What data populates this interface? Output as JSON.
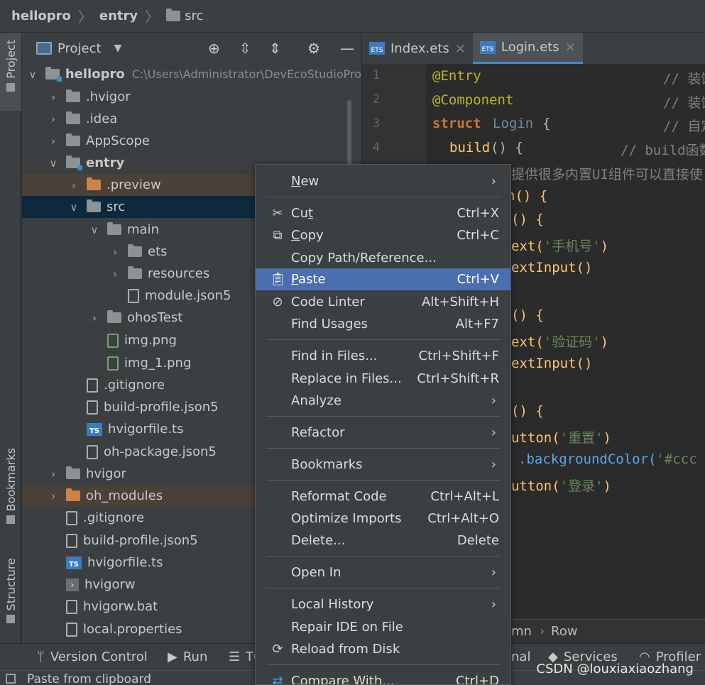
{
  "breadcrumb": {
    "project": "hellopro",
    "module": "entry",
    "folder": "src"
  },
  "left_strip": {
    "project": "Project",
    "bookmarks": "Bookmarks",
    "structure": "Structure"
  },
  "project_panel": {
    "title": "Project",
    "tree": [
      {
        "label": "hellopro",
        "path": "C:\\Users\\Administrator\\DevEcoStudioPro"
      },
      {
        "label": ".hvigor"
      },
      {
        "label": ".idea"
      },
      {
        "label": "AppScope"
      },
      {
        "label": "entry"
      },
      {
        "label": ".preview"
      },
      {
        "label": "src"
      },
      {
        "label": "main"
      },
      {
        "label": "ets"
      },
      {
        "label": "resources"
      },
      {
        "label": "module.json5"
      },
      {
        "label": "ohosTest"
      },
      {
        "label": "img.png"
      },
      {
        "label": "img_1.png"
      },
      {
        "label": ".gitignore"
      },
      {
        "label": "build-profile.json5"
      },
      {
        "label": "hvigorfile.ts"
      },
      {
        "label": "oh-package.json5"
      },
      {
        "label": "hvigor"
      },
      {
        "label": "oh_modules"
      },
      {
        "label": ".gitignore"
      },
      {
        "label": "build-profile.json5"
      },
      {
        "label": "hvigorfile.ts"
      },
      {
        "label": "hvigorw"
      },
      {
        "label": "hvigorw.bat"
      },
      {
        "label": "local.properties"
      }
    ]
  },
  "editor": {
    "tabs": [
      {
        "label": "Index.ets",
        "icon": "ETS"
      },
      {
        "label": "Login.ets",
        "icon": "ETS"
      }
    ],
    "line_numbers": [
      "1",
      "2",
      "3",
      "4"
    ],
    "code": {
      "l1_ann": "@Entry",
      "l1_cm": "// 装饰",
      "l2_ann": "@Component",
      "l2_cm": "// 装饰",
      "l3_kw": "struct",
      "l3_name": "Login",
      "l3_brace": "{",
      "l3_cm": "// 自定",
      "l4_fn": "build",
      "l4_rest": "() {",
      "l4_cm": "// build函数",
      "l5_cm": "提供很多内置UI组件可以直接使",
      "l6": "n() {",
      "l7": "() {",
      "l8_a": "ext(",
      "l8_s": "'手机号'",
      "l8_b": ")",
      "l9": "extInput()",
      "l10": "() {",
      "l11_a": "ext(",
      "l11_s": "'验证码'",
      "l11_b": ")",
      "l12": "extInput()",
      "l13": "() {",
      "l14_a": "utton(",
      "l14_s": "'重置'",
      "l14_b": ")",
      "l15_m": ".backgroundColor(",
      "l15_s": "'#ccc",
      "l16_a": "utton(",
      "l16_s": "'登录'",
      "l16_b": ")"
    },
    "bottom_crumb_a": "mn",
    "bottom_crumb_b": "Row"
  },
  "context_menu": {
    "items": [
      {
        "label": "New",
        "underline": "N",
        "rest": "ew",
        "submenu": true
      },
      {
        "label": "Cut",
        "underline": "t",
        "pre": "Cu",
        "shortcut": "Ctrl+X"
      },
      {
        "label": "Copy",
        "underline": "C",
        "rest": "opy",
        "shortcut": "Ctrl+C"
      },
      {
        "label": "Copy Path/Reference..."
      },
      {
        "label": "Paste",
        "underline": "P",
        "rest": "aste",
        "shortcut": "Ctrl+V"
      },
      {
        "label": "Code Linter",
        "shortcut": "Alt+Shift+H"
      },
      {
        "label": "Find Usages",
        "shortcut": "Alt+F7"
      },
      {
        "label": "Find in Files...",
        "shortcut": "Ctrl+Shift+F"
      },
      {
        "label": "Replace in Files...",
        "shortcut": "Ctrl+Shift+R"
      },
      {
        "label": "Analyze",
        "submenu": true
      },
      {
        "label": "Refactor",
        "submenu": true
      },
      {
        "label": "Bookmarks",
        "submenu": true
      },
      {
        "label": "Reformat Code",
        "shortcut": "Ctrl+Alt+L"
      },
      {
        "label": "Optimize Imports",
        "shortcut": "Ctrl+Alt+O"
      },
      {
        "label": "Delete...",
        "shortcut": "Delete"
      },
      {
        "label": "Open In",
        "submenu": true
      },
      {
        "label": "Local History",
        "submenu": true
      },
      {
        "label": "Repair IDE on File"
      },
      {
        "label": "Reload from Disk"
      },
      {
        "label": "Compare With...",
        "shortcut": "Ctrl+D"
      }
    ]
  },
  "bottom_bar": {
    "version_control": "Version Control",
    "run": "Run",
    "todo": "TO",
    "terminal": "nal",
    "services": "Services",
    "profiler": "Profiler"
  },
  "status": {
    "text": "Paste from clipboard"
  },
  "watermark": "CSDN @louxiaxiaozhang",
  "colors": {
    "selection": "#4b6eaf",
    "tree_selected": "#0d293e",
    "excluded_folder": "#d0804a",
    "background": "#2b2b2b",
    "panel": "#3c3f41"
  }
}
